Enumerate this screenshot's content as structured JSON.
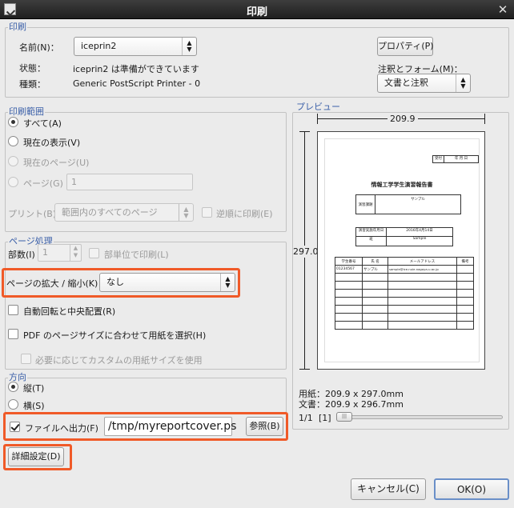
{
  "window": {
    "title": "印刷"
  },
  "printer": {
    "section_label": "印刷",
    "name_label": "名前(N)：",
    "name_value": "iceprin2",
    "status_label": "状態：",
    "status_value": "iceprin2 は準備ができています",
    "type_label": "種類：",
    "type_value": "Generic PostScript Printer -  0",
    "properties_button": "プロパティ(P)",
    "annotation_label": "注釈とフォーム(M)：",
    "annotation_value": "文書と注釈"
  },
  "range": {
    "section_label": "印刷範囲",
    "all": "すべて(A)",
    "current_view": "現在の表示(V)",
    "current_page": "現在のページ(U)",
    "pages": "ページ(G)",
    "pages_value": "1",
    "print_label": "プリント(B)：",
    "print_value": "範囲内のすべてのページ",
    "reverse": "逆順に印刷(E)"
  },
  "handling": {
    "section_label": "ページ処理",
    "copies_label": "部数(I)",
    "copies_value": "1",
    "collate": "部単位で印刷(L)",
    "scale_label": "ページの拡大 / 縮小(K)",
    "scale_value": "なし",
    "auto_rotate": "自動回転と中央配置(R)",
    "pdf_paper": "PDF のページサイズに合わせて用紙を選択(H)",
    "custom_paper": "必要に応じてカスタムの用紙サイズを使用"
  },
  "orientation": {
    "section_label": "方向",
    "portrait": "縦(T)",
    "landscape": "横(S)"
  },
  "output": {
    "file_label": "ファイルへ出力(F)",
    "file_path": "/tmp/myreportcover.ps",
    "browse_button": "参照(B)",
    "advanced_button": "詳細設定(D)"
  },
  "preview": {
    "section_label": "プレビュー",
    "width_dim": "209.9",
    "height_dim": "297.0",
    "paper_info": "用紙：209.9 x 297.0mm",
    "doc_info": "文書：209.9 x 296.7mm",
    "page_indicator": "1/1",
    "page_number": "[1]",
    "doc": {
      "stamp1": "受付",
      "stamp2": "年 月 日",
      "title": "情報工学学生演習報告書",
      "box_label": "演習課題",
      "box_value": "サンプル",
      "row1_label": "演習実施年月日",
      "row1_value": "2016年4月14日",
      "row2_label": "班",
      "row2_value": "Sample",
      "col_headers": [
        "学生番号",
        "氏 名",
        "メールアドレス",
        "備考"
      ],
      "first_row": [
        "01234567",
        "サンプル",
        "sample@ice.nuie.nagoya-u.ac.jp",
        ""
      ]
    }
  },
  "footer": {
    "cancel_button": "キャンセル(C)",
    "ok_button": "OK(O)"
  }
}
